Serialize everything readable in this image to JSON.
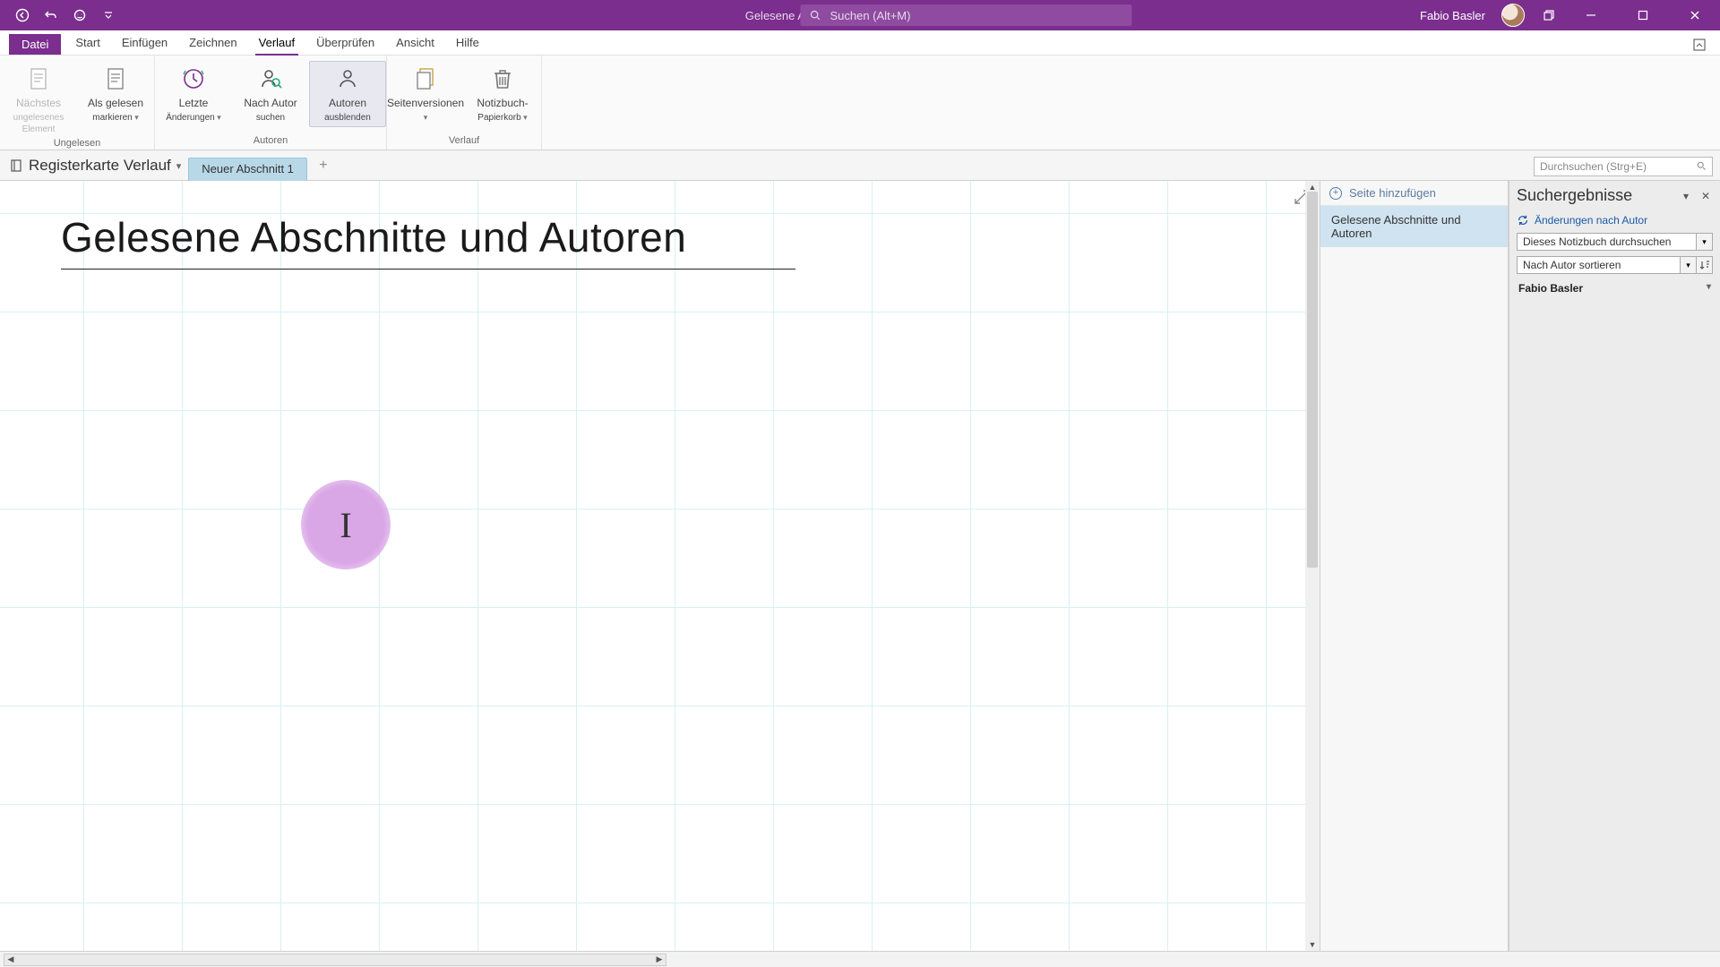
{
  "titlebar": {
    "doc_title": "Gelesene Abschnitte und Autoren  -  OneNote",
    "search_placeholder": "Suchen (Alt+M)",
    "user_name": "Fabio Basler"
  },
  "menu": {
    "file": "Datei",
    "items": [
      "Start",
      "Einfügen",
      "Zeichnen",
      "Verlauf",
      "Überprüfen",
      "Ansicht",
      "Hilfe"
    ],
    "active_index": 3
  },
  "ribbon": {
    "groups": [
      {
        "label": "Ungelesen",
        "buttons": [
          {
            "id": "next-unread",
            "line1": "Nächstes",
            "line2": "ungelesenes Element",
            "disabled": true,
            "caret": false,
            "icon": "page"
          },
          {
            "id": "mark-read",
            "line1": "Als gelesen",
            "line2": "markieren",
            "disabled": false,
            "caret": true,
            "icon": "page-check"
          }
        ]
      },
      {
        "label": "Autoren",
        "buttons": [
          {
            "id": "recent-changes",
            "line1": "Letzte",
            "line2": "Änderungen",
            "disabled": false,
            "caret": true,
            "icon": "clock"
          },
          {
            "id": "find-by-author",
            "line1": "Nach Autor",
            "line2": "suchen",
            "disabled": false,
            "caret": false,
            "icon": "person-search"
          },
          {
            "id": "hide-authors",
            "line1": "Autoren",
            "line2": "ausblenden",
            "disabled": false,
            "caret": false,
            "icon": "person",
            "pressed": true
          }
        ]
      },
      {
        "label": "Verlauf",
        "buttons": [
          {
            "id": "page-versions",
            "line1": "Seitenversionen",
            "line2": "",
            "disabled": false,
            "caret": true,
            "icon": "page-stack"
          },
          {
            "id": "recycle-bin",
            "line1": "Notizbuch-",
            "line2": "Papierkorb",
            "disabled": false,
            "caret": true,
            "icon": "trash"
          }
        ]
      }
    ]
  },
  "notebook": {
    "name": "Registerkarte Verlauf",
    "section_tab": "Neuer Abschnitt 1",
    "page_search_placeholder": "Durchsuchen (Strg+E)"
  },
  "page": {
    "title": "Gelesene Abschnitte und Autoren",
    "cursor_glyph": "I"
  },
  "pagelist": {
    "add_label": "Seite hinzufügen",
    "items": [
      "Gelesene Abschnitte und Autoren"
    ],
    "active_index": 0
  },
  "searchpanel": {
    "title": "Suchergebnisse",
    "changes_by_author": "Änderungen nach Autor",
    "scope": "Dieses Notizbuch durchsuchen",
    "sort": "Nach Autor sortieren",
    "author": "Fabio Basler"
  }
}
